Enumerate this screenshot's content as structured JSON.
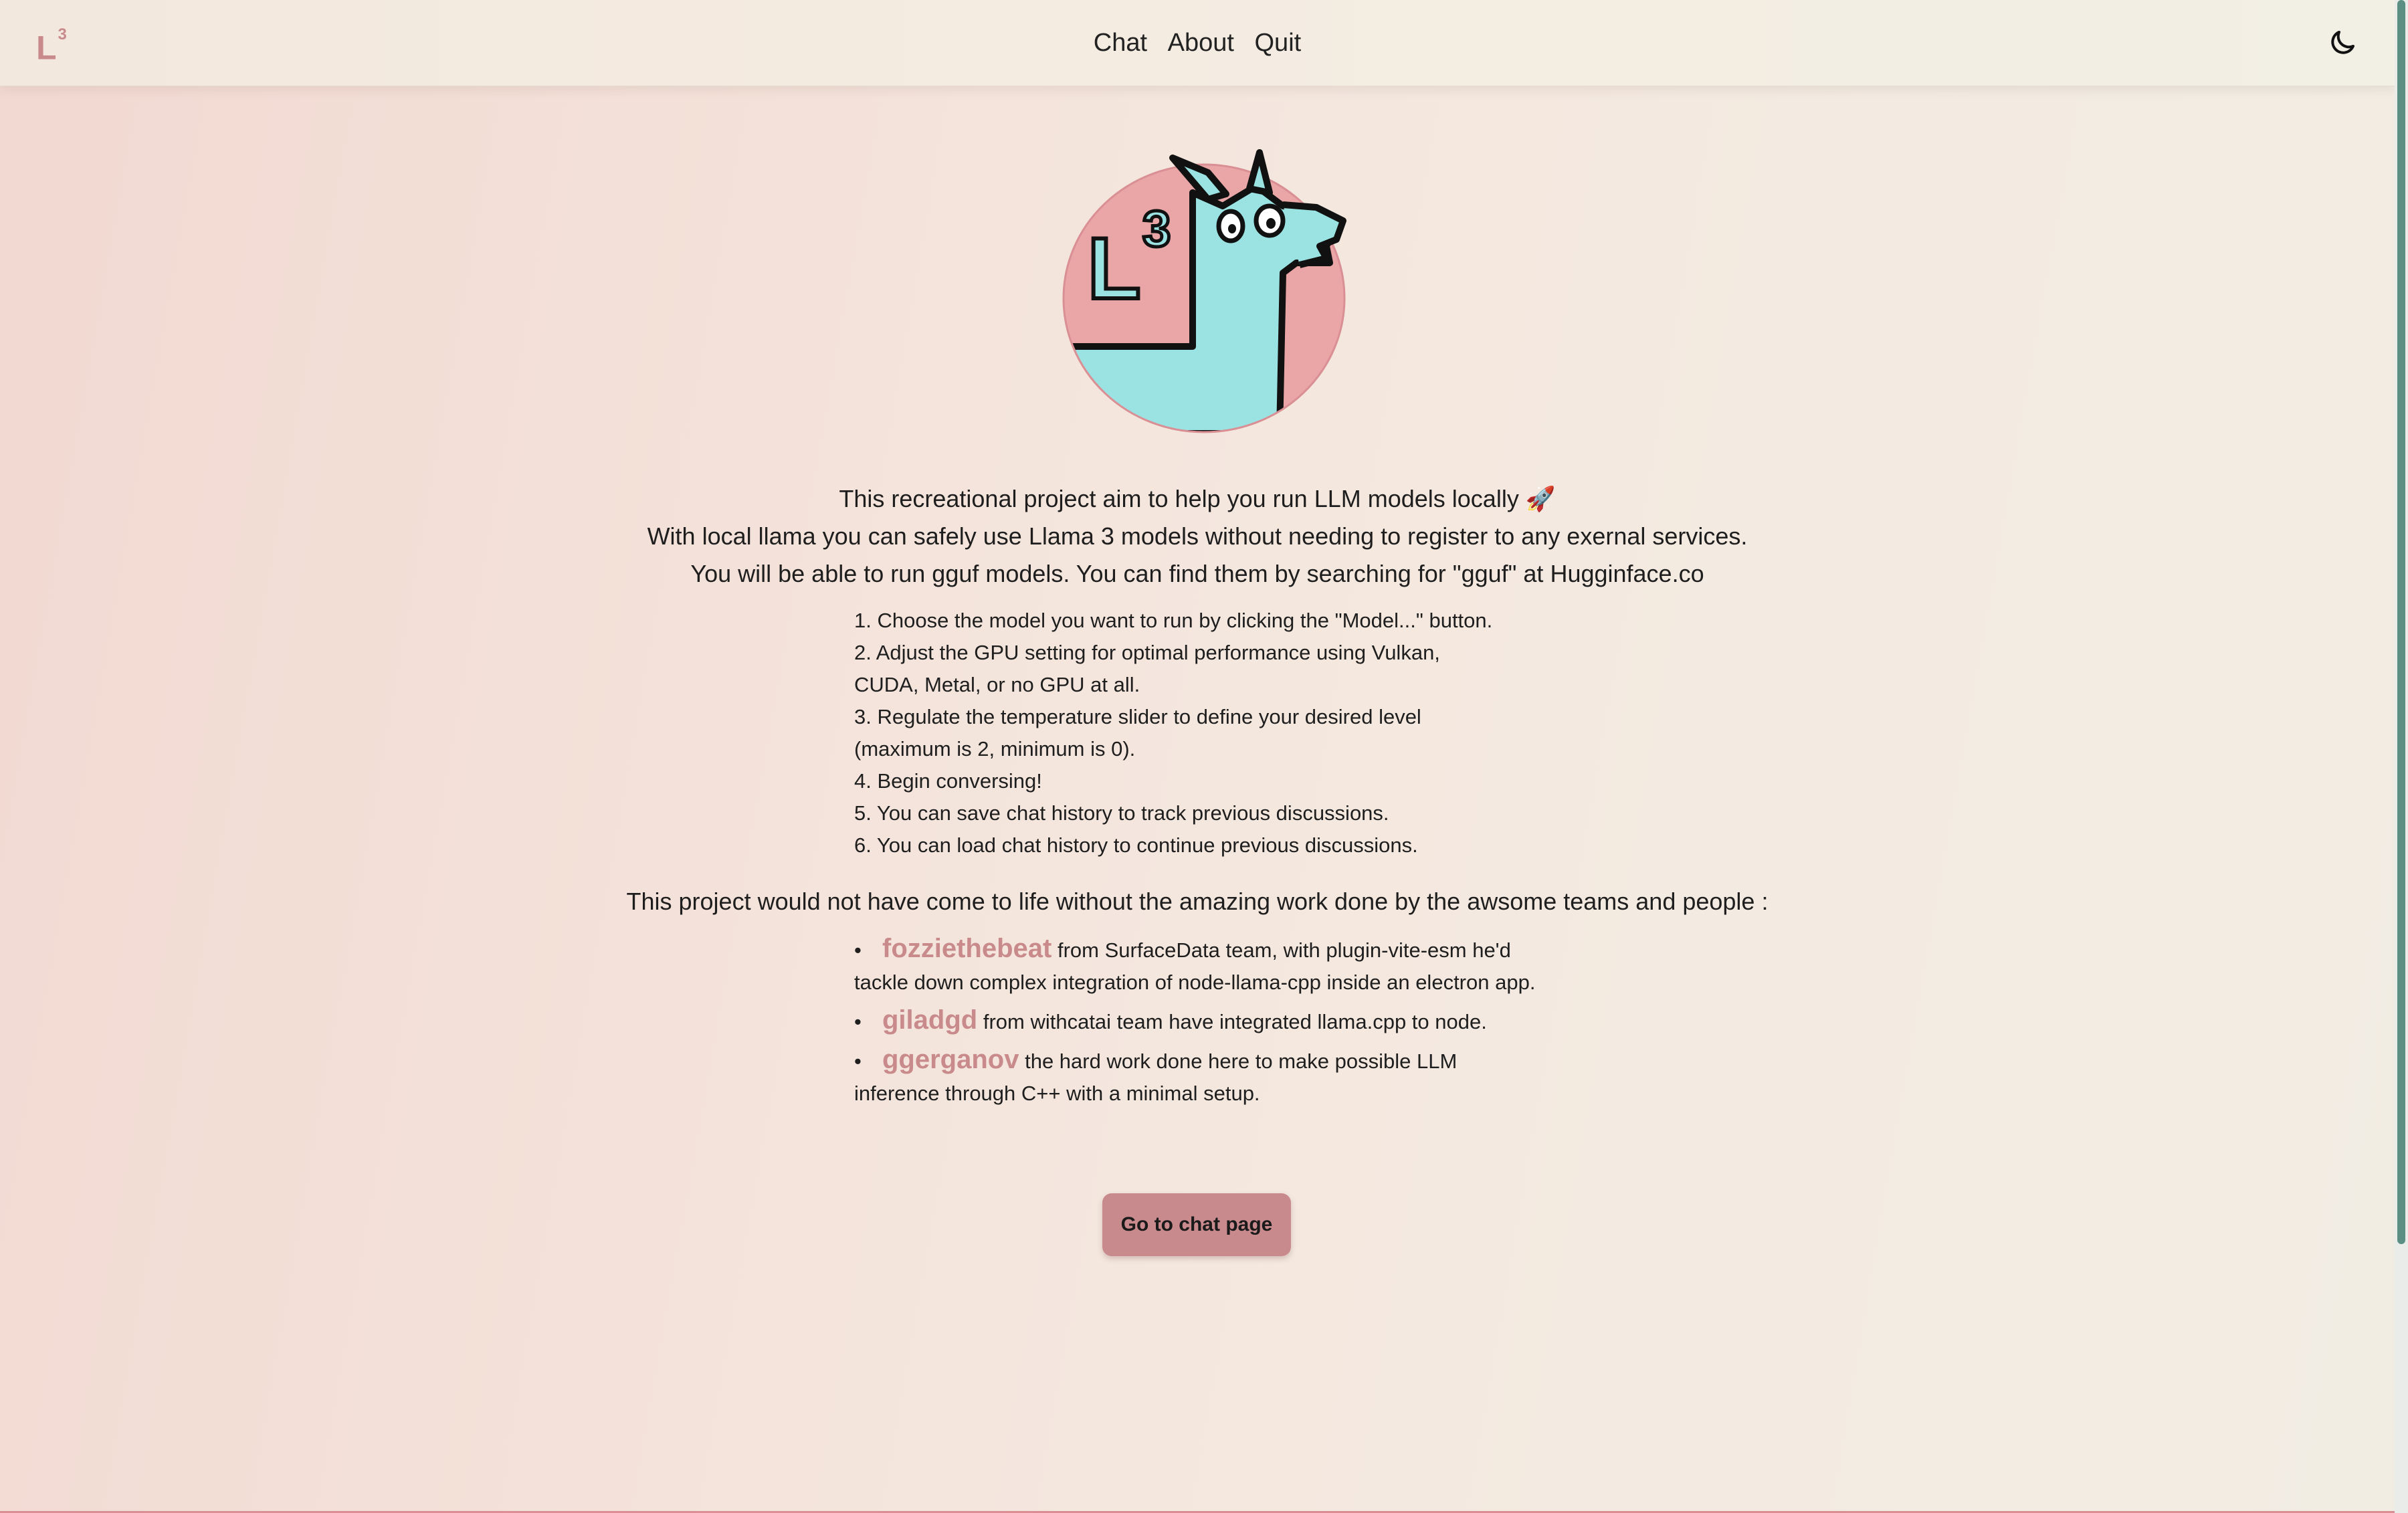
{
  "header": {
    "brand": "L",
    "brand_sup": "3",
    "nav": [
      {
        "label": "Chat"
      },
      {
        "label": "About"
      },
      {
        "label": "Quit"
      }
    ],
    "theme_icon": "moon-icon"
  },
  "logo": {
    "icon": "llama-logo-icon",
    "text_l": "L",
    "text_3": "3"
  },
  "intro": {
    "line1": "This recreational project aim to help you run LLM models locally 🚀",
    "line2": "With local llama you can safely use Llama 3 models without needing to register to any exernal services.",
    "line3": "You will be able to run gguf models. You can find them by searching for \"gguf\" at Hugginface.co"
  },
  "steps": [
    "1. Choose the model you want to run by clicking the \"Model...\" button.",
    "2. Adjust the GPU setting for optimal performance using Vulkan,\nCUDA, Metal, or no GPU at all.",
    "3. Regulate the temperature slider to define your desired level\n(maximum is 2, minimum is 0).",
    "4. Begin conversing!",
    "5. You can save chat history to track previous discussions.",
    "6. You can load chat history to continue previous discussions."
  ],
  "thanks": "This project would not have come to life without the amazing work done by the awsome teams and people :",
  "credits": [
    {
      "name": "fozziethebeat",
      "text": " from SurfaceData team, with plugin-vite-esm he'd tackle down complex integration of node-llama-cpp inside an electron app."
    },
    {
      "name": "giladgd",
      "text": " from withcatai team have integrated llama.cpp to node."
    },
    {
      "name": "ggerganov",
      "text": " the hard work done here to make possible LLM inference through C++ with a minimal setup."
    }
  ],
  "cta": {
    "label": "Go to chat page"
  },
  "colors": {
    "accent": "#c98a8e",
    "llama": "#9be3e3",
    "circle": "#eaa6a6"
  }
}
